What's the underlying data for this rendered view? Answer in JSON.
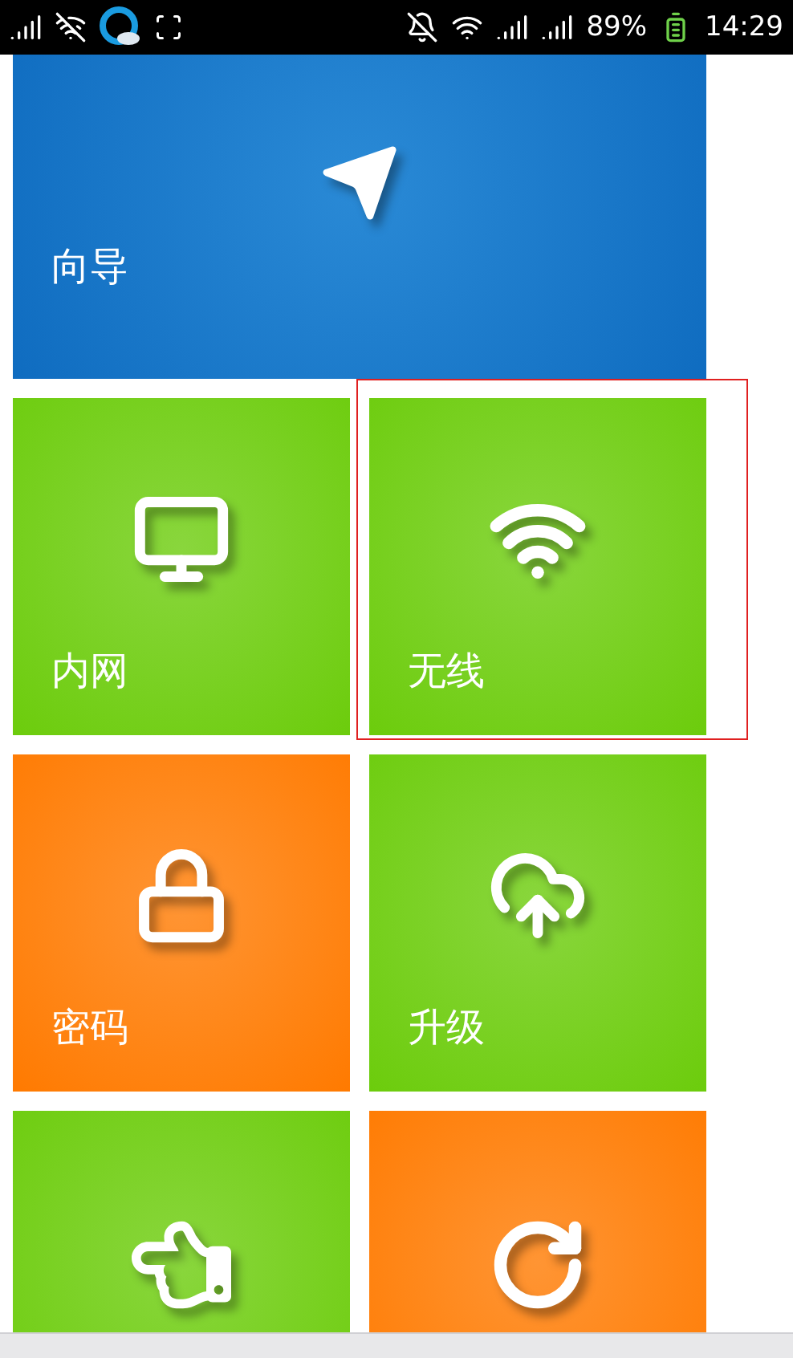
{
  "status_bar": {
    "battery": "89%",
    "time": "14:29"
  },
  "hero_tile": {
    "label": "向导",
    "color": "#0f6cc0",
    "kind": "plane"
  },
  "tiles": [
    {
      "label": "内网",
      "color": "#6ccc0c",
      "kind": "monitor"
    },
    {
      "label": "无线",
      "color": "#6ccc0c",
      "kind": "wifi",
      "highlighted": true
    },
    {
      "label": "密码",
      "color": "#ff7a00",
      "kind": "lock"
    },
    {
      "label": "升级",
      "color": "#6ccc0c",
      "kind": "cloud"
    },
    {
      "color": "#6ccc0c",
      "kind": "hand"
    },
    {
      "color": "#ff7a00",
      "kind": "refresh"
    }
  ]
}
